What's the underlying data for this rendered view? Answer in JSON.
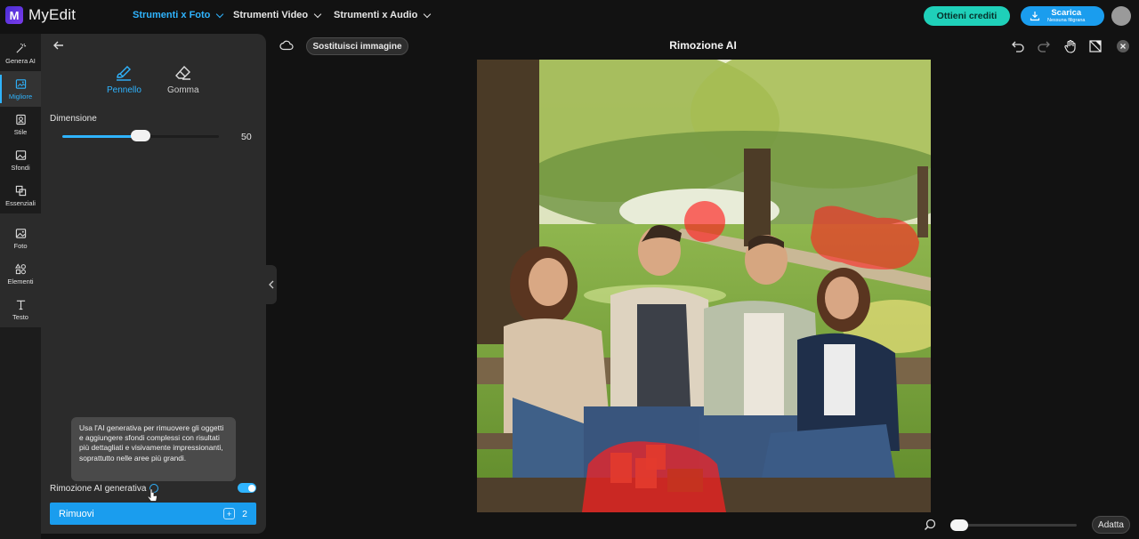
{
  "app": {
    "logo_text": "MyEdit",
    "logo_letter": "M"
  },
  "topnav": [
    {
      "label": "Strumenti x Foto",
      "active": true
    },
    {
      "label": "Strumenti Video",
      "active": false
    },
    {
      "label": "Strumenti x Audio",
      "active": false
    }
  ],
  "header": {
    "credits_label": "Ottieni crediti",
    "download_label": "Scarica",
    "download_sublabel": "Nessuna filigrana"
  },
  "rail": {
    "items": [
      {
        "label": "Genera AI",
        "icon": "magic-wand-icon"
      },
      {
        "label": "Migliore",
        "icon": "enhance-image-icon",
        "active": true
      },
      {
        "label": "Stile",
        "icon": "style-icon"
      },
      {
        "label": "Sfondi",
        "icon": "background-icon"
      },
      {
        "label": "Essenziali",
        "icon": "crop-icon"
      },
      {
        "label": "Foto",
        "icon": "photo-icon"
      },
      {
        "label": "Elementi",
        "icon": "elements-icon"
      },
      {
        "label": "Testo",
        "icon": "text-icon"
      }
    ]
  },
  "panel": {
    "tools": [
      {
        "label": "Pennello",
        "icon": "brush-icon",
        "active": true
      },
      {
        "label": "Gomma",
        "icon": "eraser-icon",
        "active": false
      }
    ],
    "size_label": "Dimensione",
    "size_value": "50",
    "size_fraction": 0.5,
    "tooltip": "Usa l'AI generativa per rimuovere gli oggetti e aggiungere sfondi complessi con risultati più dettagliati e visivamente impressionanti, soprattutto nelle aree più grandi.",
    "generative_label": "Rimozione AI generativa",
    "generative_enabled": true,
    "remove_label": "Rimuovi",
    "remove_cost": "2"
  },
  "canvas": {
    "replace_label": "Sostituisci immagine",
    "title": "Rimozione AI",
    "fit_label": "Adatta",
    "zoom_fraction": 0.0
  },
  "colors": {
    "accent": "#1a9dee",
    "credits": "#1fd0b9",
    "mask": "#ff2020"
  }
}
